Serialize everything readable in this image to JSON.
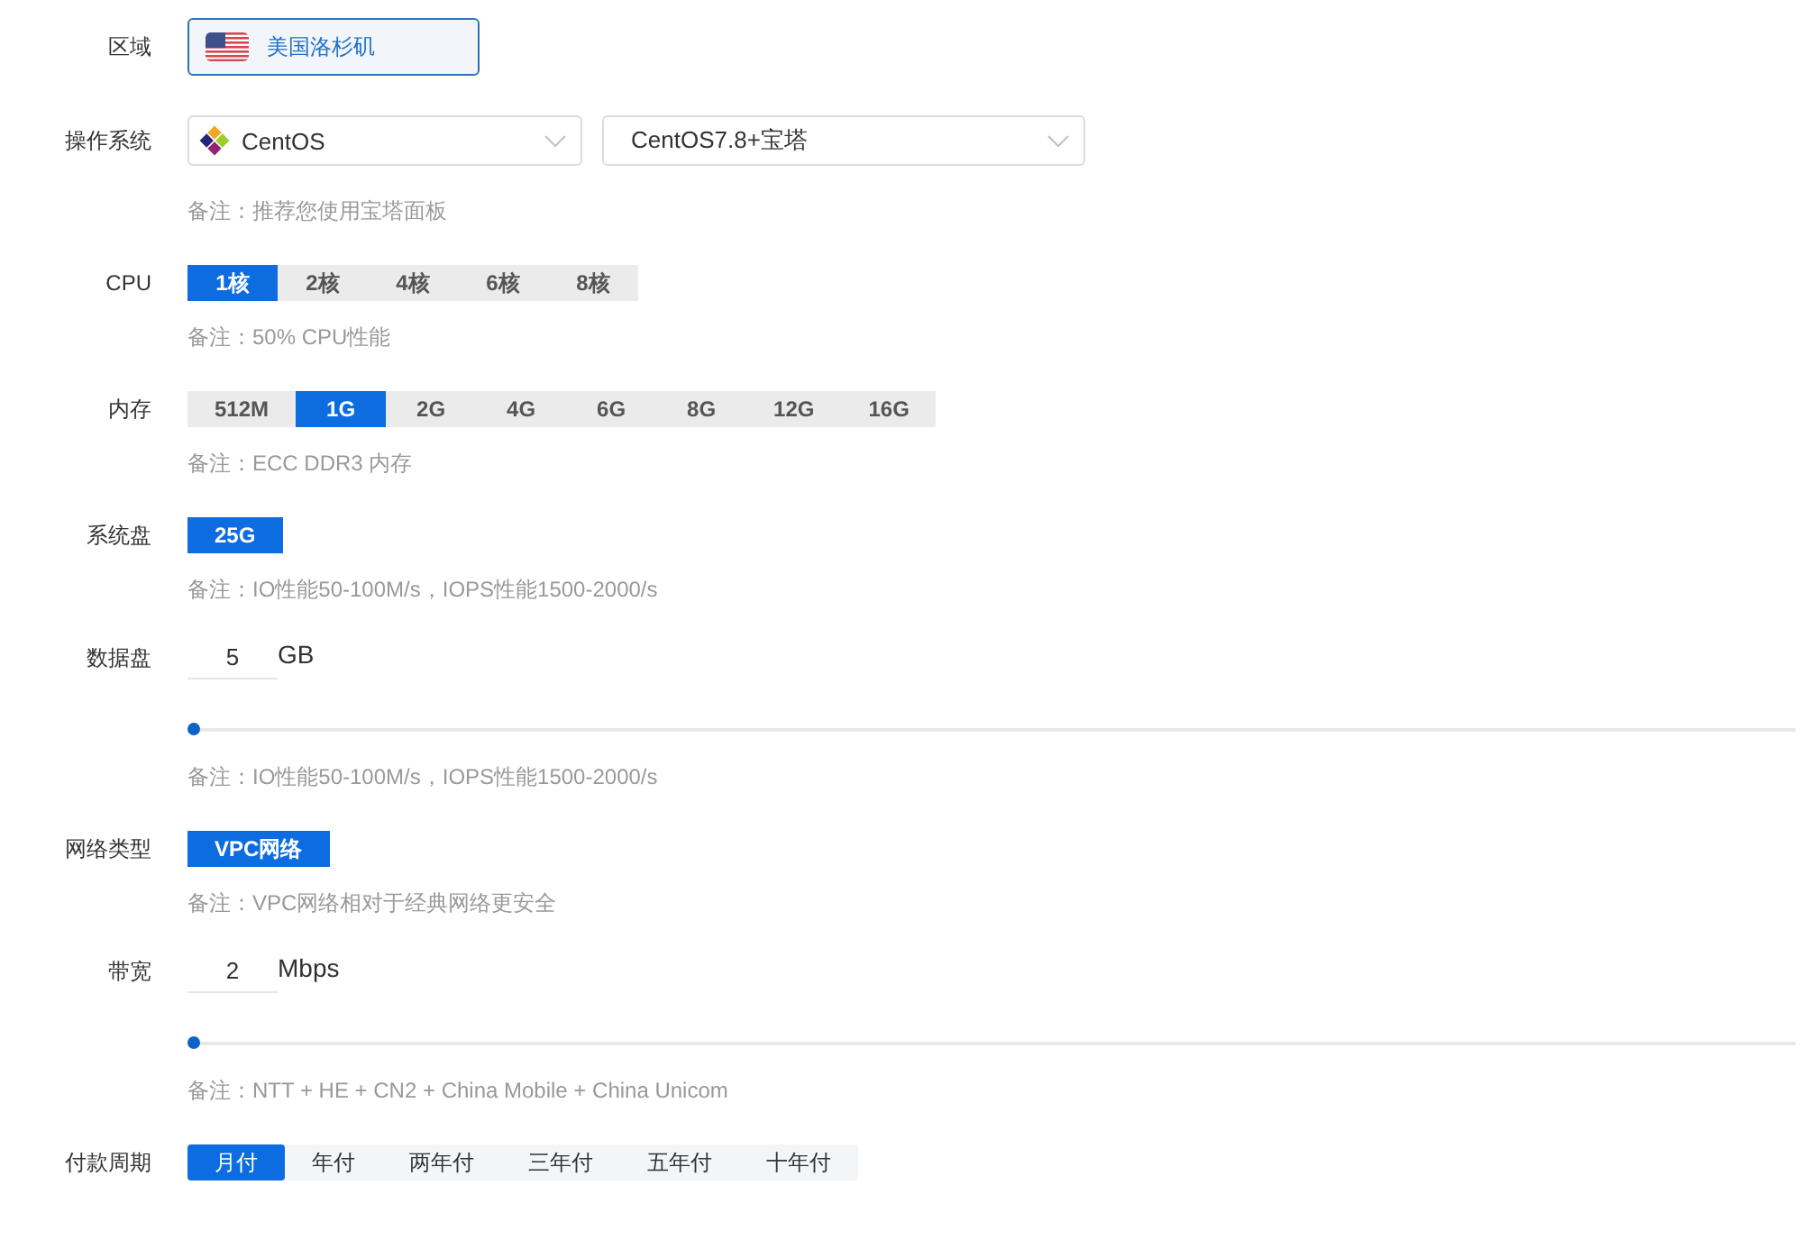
{
  "rows": [
    {
      "kind": "region",
      "label": "区域",
      "button": {
        "text": "美国洛杉矶",
        "selected": true
      }
    },
    {
      "kind": "selects",
      "label": "操作系统",
      "selects": [
        {
          "kind": "os",
          "value": "CentOS"
        },
        {
          "kind": "version",
          "value": "CentOS7.8+宝塔"
        }
      ],
      "note": "备注：推荐您使用宝塔面板"
    },
    {
      "kind": "options",
      "label": "CPU",
      "options": [
        {
          "text": "1核",
          "selected": true
        },
        {
          "text": "2核",
          "selected": false
        },
        {
          "text": "4核",
          "selected": false
        },
        {
          "text": "6核",
          "selected": false
        },
        {
          "text": "8核",
          "selected": false
        }
      ],
      "note": "备注：50% CPU性能"
    },
    {
      "kind": "options",
      "label": "内存",
      "options": [
        {
          "text": "512M",
          "selected": false
        },
        {
          "text": "1G",
          "selected": true
        },
        {
          "text": "2G",
          "selected": false
        },
        {
          "text": "4G",
          "selected": false
        },
        {
          "text": "6G",
          "selected": false
        },
        {
          "text": "8G",
          "selected": false
        },
        {
          "text": "12G",
          "selected": false
        },
        {
          "text": "16G",
          "selected": false
        }
      ],
      "note": "备注：ECC DDR3 内存"
    },
    {
      "kind": "options",
      "label": "系统盘",
      "options": [
        {
          "text": "25G",
          "selected": true
        }
      ],
      "note": "备注：IO性能50-100M/s，IOPS性能1500-2000/s"
    },
    {
      "kind": "slider",
      "label": "数据盘",
      "value": "5",
      "unit": "GB",
      "level": 0,
      "note": "备注：IO性能50-100M/s，IOPS性能1500-2000/s"
    },
    {
      "kind": "options",
      "label": "网络类型",
      "options": [
        {
          "text": "VPC网络",
          "selected": true
        }
      ],
      "note": "备注：VPC网络相对于经典网络更安全"
    },
    {
      "kind": "slider",
      "label": "带宽",
      "value": "2",
      "unit": "Mbps",
      "level": 0,
      "note": "备注：NTT + HE + CN2 + China Mobile + China Unicom"
    },
    {
      "kind": "periods",
      "label": "付款周期",
      "options": [
        {
          "text": "月付",
          "selected": true
        },
        {
          "text": "年付",
          "selected": false
        },
        {
          "text": "两年付",
          "selected": false
        },
        {
          "text": "三年付",
          "selected": false
        },
        {
          "text": "五年付",
          "selected": false
        },
        {
          "text": "十年付",
          "selected": false
        }
      ]
    }
  ]
}
